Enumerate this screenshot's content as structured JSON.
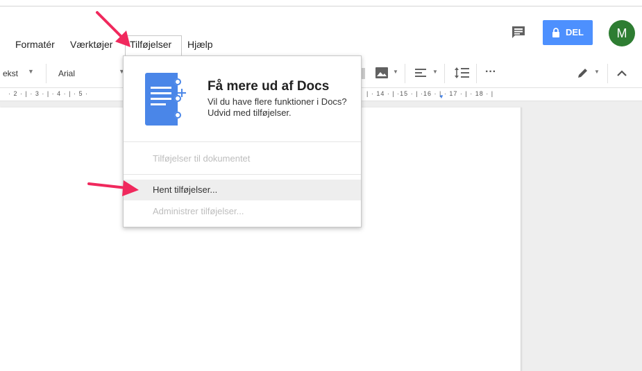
{
  "menubar": {
    "items": [
      "Formatér",
      "Værktøjer",
      "Tilføjelser",
      "Hjælp"
    ]
  },
  "header": {
    "share_label": "DEL",
    "avatar_letter": "M"
  },
  "toolbar": {
    "style_label": "ekst",
    "font_label": "Arial",
    "more_label": "···"
  },
  "ruler": {
    "left_marks": "· 2 · | · 3 · | · 4 · | · 5 ·",
    "right_marks": "| · 14 · | ·15 · | ·16 · | · 17 · | · 18 · |"
  },
  "dropdown": {
    "promo_title": "Få mere ud af Docs",
    "promo_desc": "Vil du have flere funktioner i Docs? Udvid med tilføjelser.",
    "section_header": "Tilføjelser til dokumentet",
    "get_addons": "Hent tilføjelser...",
    "manage_addons": "Administrer tilføjelser..."
  },
  "colors": {
    "accent": "#4d90fe",
    "avatar": "#2e7d32",
    "arrow": "#f0295d",
    "docs_blue": "#4a86e8"
  }
}
